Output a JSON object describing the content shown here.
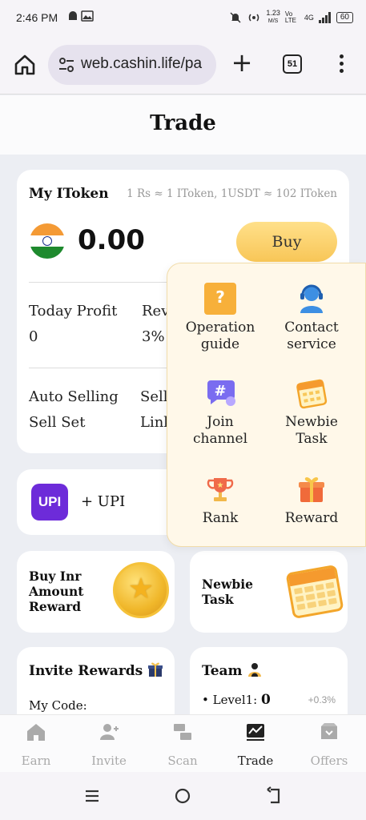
{
  "status_bar": {
    "time": "2:46 PM",
    "speed": "1.23",
    "speed_unit": "M/S",
    "network": "4G",
    "volte": "Vo LTE",
    "battery": "60"
  },
  "browser": {
    "url": "web.cashin.life/pa",
    "tab_count": "51"
  },
  "page": {
    "title": "Trade"
  },
  "token_card": {
    "title": "My IToken",
    "rate": "1 Rs ≈ 1 IToken, 1USDT ≈ 102 IToken",
    "balance": "0.00",
    "buy_label": "Buy",
    "today_profit_label": "Today Profit",
    "today_profit_value": "0",
    "rev_label": "Rev",
    "rev_value": "3%",
    "auto_selling_label": "Auto Selling",
    "sell_label": "Sell",
    "sell_set_label": "Sell Set",
    "link_label": "Link"
  },
  "upi_card": {
    "badge": "UPI",
    "label": "+ UPI"
  },
  "promo_cards": {
    "buy_inr_line1": "Buy Inr",
    "buy_inr_line2": "Amount",
    "buy_inr_line3": "Reward",
    "newbie_line1": "Newbie",
    "newbie_line2": "Task"
  },
  "bottom_cards": {
    "invite_title": "Invite Rewards",
    "code_label": "My Code:",
    "team_title": "Team",
    "level_label": "Level1:",
    "level_value": "0",
    "level_pct": "+0.3%"
  },
  "popup_menu": {
    "items": [
      {
        "line1": "Operation",
        "line2": "guide",
        "icon": "question-book-icon"
      },
      {
        "line1": "Contact",
        "line2": "service",
        "icon": "headset-agent-icon"
      },
      {
        "line1": "Join",
        "line2": "channel",
        "icon": "hashtag-chat-icon"
      },
      {
        "line1": "Newbie",
        "line2": "Task",
        "icon": "calendar-icon"
      },
      {
        "line1": "Rank",
        "line2": "",
        "icon": "trophy-icon"
      },
      {
        "line1": "Reward",
        "line2": "",
        "icon": "gift-icon"
      }
    ]
  },
  "bottom_nav": {
    "items": [
      {
        "label": "Earn",
        "icon": "house-icon"
      },
      {
        "label": "Invite",
        "icon": "add-user-icon"
      },
      {
        "label": "Scan",
        "icon": "scan-icon"
      },
      {
        "label": "Trade",
        "icon": "chart-icon",
        "active": true
      },
      {
        "label": "Offers",
        "icon": "offers-box-icon"
      }
    ]
  },
  "colors": {
    "buy_gradient": "#f8c657",
    "upi_purple": "#6d2bd9",
    "popup_bg": "#fff8e9"
  }
}
